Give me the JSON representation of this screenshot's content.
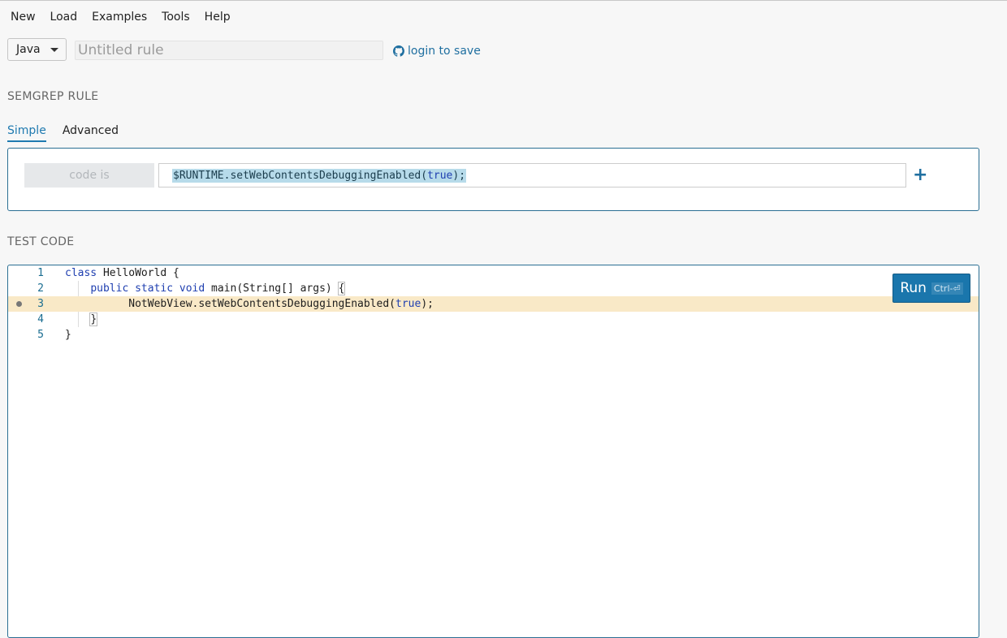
{
  "menu": [
    "New",
    "Load",
    "Examples",
    "Tools",
    "Help"
  ],
  "header": {
    "language": "Java",
    "rule_name_placeholder": "Untitled rule",
    "login_label": "login to save"
  },
  "rule_section": {
    "title": "SEMGREP RULE",
    "tabs": [
      {
        "label": "Simple",
        "active": true
      },
      {
        "label": "Advanced",
        "active": false
      }
    ],
    "operator_label": "code is",
    "pattern_prefix": "$RUNTIME.setWebContentsDebuggingEnabled(",
    "pattern_keyword": "true",
    "pattern_suffix": ");",
    "add_label": "+"
  },
  "test_section": {
    "title": "TEST CODE",
    "run_label": "Run",
    "run_shortcut": "Ctrl-⏎",
    "lines": [
      {
        "num": "1",
        "text": "class HelloWorld {",
        "highlight": false
      },
      {
        "num": "2",
        "text": "    public static void main(String[] args) {",
        "highlight": false
      },
      {
        "num": "3",
        "text": "        NotWebView.setWebContentsDebuggingEnabled(true);",
        "highlight": true
      },
      {
        "num": "4",
        "text": "    }",
        "highlight": false
      },
      {
        "num": "5",
        "text": "}",
        "highlight": false
      }
    ]
  },
  "colors": {
    "accent": "#1a76ac",
    "match_highlight": "#f9e9c7",
    "pattern_selection": "#b7dbea"
  }
}
